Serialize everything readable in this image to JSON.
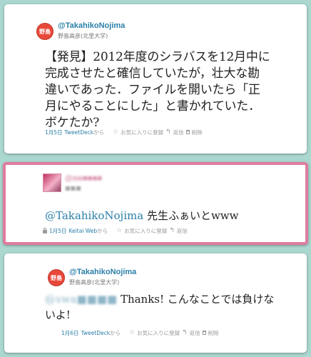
{
  "colors": {
    "background": "#aad7cf",
    "card_border_highlight": "#e07ca0",
    "link": "#2a7fa8"
  },
  "tweets": [
    {
      "avatar_text": "野島",
      "handle": "@TakahikoNojima",
      "name": "野島高彦(北里大学)",
      "lines": [
        "【発見】2012年度のシラバスを12月中に",
        "完成させたと確信していたが，壮大な勘",
        "違いであった．ファイルを開いたら「正",
        "月にやることにした」と書かれていた．",
        "ボケたか?"
      ],
      "date": "1月5日",
      "source": "TweetDeck",
      "source_suffix": "から",
      "favorite": "お気に入りに登録",
      "reply": "返信",
      "delete": "削除"
    },
    {
      "handle": "@sw■■■■",
      "name": "■■■",
      "mention": "@TakahikoNojima",
      "body": " 先生ふぁいとwww",
      "date": "1月5日",
      "source": "Keitai Web",
      "source_suffix": "から",
      "favorite": "お気に入りに登録",
      "reply": "返信"
    },
    {
      "avatar_text": "野島",
      "handle": "@TakahikoNojima",
      "name": "野島高彦(北里大学)",
      "mention": "@swa■■■■",
      "line1": " Thanks! こんなことでは負けな",
      "line2": "いよ!",
      "date": "1月6日",
      "source": "TweetDeck",
      "source_suffix": "から",
      "favorite": "お気に入りに登録",
      "reply": "返信",
      "delete": "削除"
    }
  ]
}
